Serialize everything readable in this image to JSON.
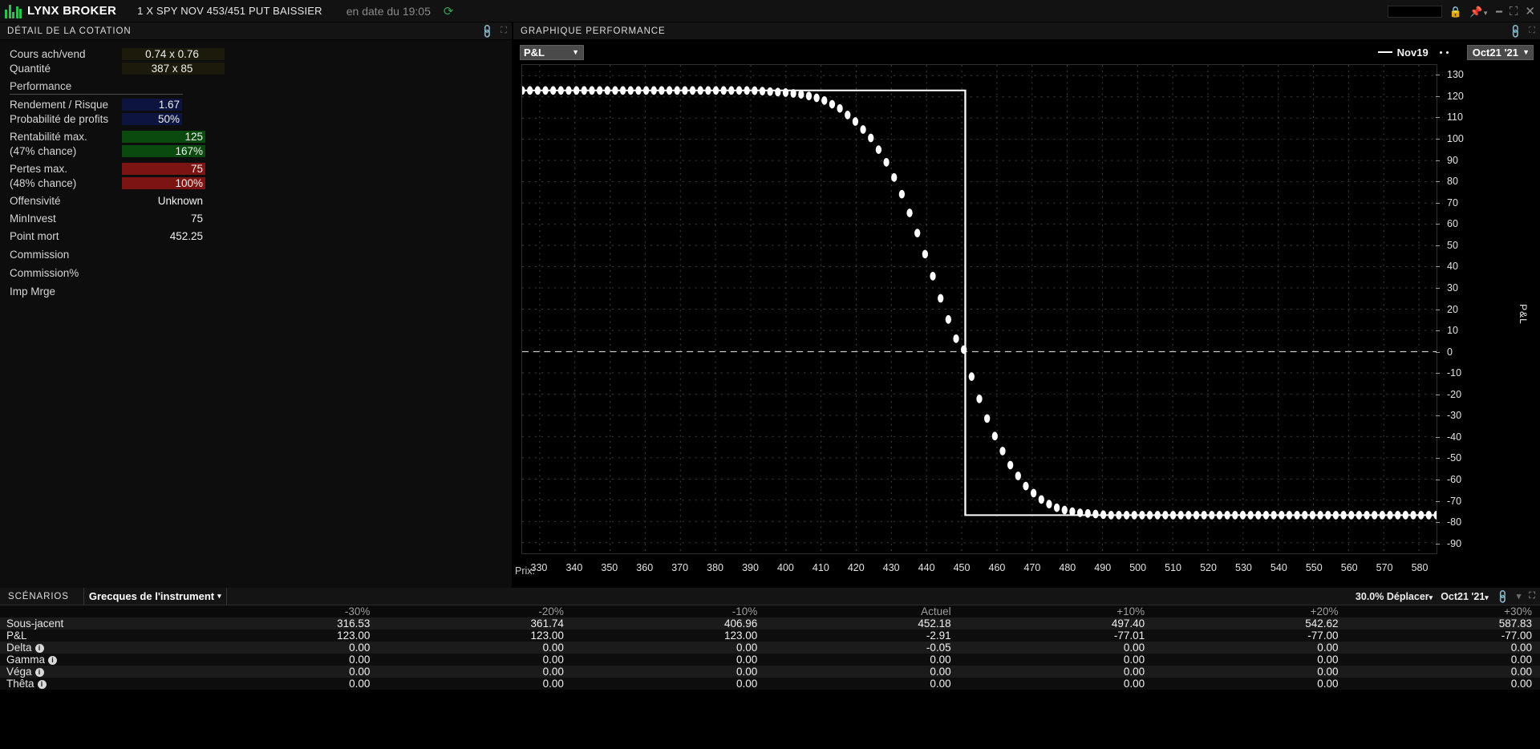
{
  "titlebar": {
    "brand": "LYNX BROKER",
    "instrument": "1 X SPY NOV 453/451 PUT BAISSIER",
    "asof": "en date du 19:05",
    "refresh_icon": "refresh-icon",
    "lock_icon": "lock-icon",
    "pin_icon": "pin-icon",
    "minimize_icon": "minimize-icon",
    "maximize_icon": "maximize-icon",
    "close_icon": "close-icon"
  },
  "quote_panel": {
    "title": "DÉTAIL DE LA COTATION",
    "link_icon": "link-icon",
    "expand_icon": "expand-icon",
    "rows": [
      {
        "label": "Cours ach/vend",
        "value": "0.74 x 0.76"
      },
      {
        "label": "Quantité",
        "value": "387 x 85"
      },
      {
        "label": "Performance",
        "value": ""
      },
      {
        "label": "Rendement / Risque",
        "value": "1.67"
      },
      {
        "label": "Probabilité de profits",
        "value": "50%"
      },
      {
        "label": "Rentabilité max.",
        "value": "125"
      },
      {
        "label": "(47% chance)",
        "value": "167%"
      },
      {
        "label": "Pertes max.",
        "value": "75"
      },
      {
        "label": "(48% chance)",
        "value": "100%"
      },
      {
        "label": "Offensivité",
        "value": "Unknown"
      },
      {
        "label": "MinInvest",
        "value": "75"
      },
      {
        "label": "Point mort",
        "value": "452.25"
      },
      {
        "label": "Commission",
        "value": ""
      },
      {
        "label": "Commission%",
        "value": ""
      },
      {
        "label": "Imp Mrge",
        "value": ""
      }
    ]
  },
  "chart_panel": {
    "title": "GRAPHIQUE PERFORMANCE",
    "link_icon": "link-icon",
    "expand_icon": "expand-icon",
    "metric_select": "P&L",
    "metric_caret": "▼",
    "legend_line": "Nov19",
    "date_select": "Oct21 '21",
    "date_caret": "▼",
    "x_prefix": "Prix:"
  },
  "chart_data": {
    "type": "line",
    "title": "GRAPHIQUE PERFORMANCE",
    "xlabel": "Prix:",
    "ylabel": "P&L",
    "xlim": [
      325,
      585
    ],
    "ylim": [
      -95,
      135
    ],
    "grid": true,
    "legend_position": "top-right",
    "x_ticks": [
      330,
      340,
      350,
      360,
      370,
      380,
      390,
      400,
      410,
      420,
      430,
      440,
      450,
      460,
      470,
      480,
      490,
      500,
      510,
      520,
      530,
      540,
      550,
      560,
      570,
      580
    ],
    "y_ticks": [
      130,
      120,
      110,
      100,
      90,
      80,
      70,
      60,
      50,
      40,
      30,
      20,
      10,
      0,
      -10,
      -20,
      -30,
      -40,
      -50,
      -60,
      -70,
      -80,
      -90
    ],
    "zero_line": 0,
    "series": [
      {
        "name": "Nov19",
        "style": "solid",
        "color": "#ffffff",
        "x": [
          325,
          451,
          451,
          585
        ],
        "values": [
          123,
          123,
          -77,
          -77
        ]
      },
      {
        "name": "Oct21 '21",
        "style": "dotted",
        "color": "#ffffff",
        "x": [
          325,
          330,
          340,
          350,
          360,
          370,
          380,
          390,
          400,
          405,
          410,
          415,
          420,
          424,
          428,
          432,
          436,
          440,
          444,
          448,
          451,
          452,
          456,
          460,
          464,
          468,
          472,
          476,
          480,
          484,
          488,
          492,
          496,
          500,
          510,
          520,
          530,
          540,
          550,
          560,
          570,
          580,
          585
        ],
        "values": [
          123,
          123,
          123,
          123,
          123,
          123,
          123,
          123,
          122,
          121,
          119,
          115,
          108,
          101,
          91,
          78,
          62,
          44,
          25,
          7,
          0,
          -8,
          -27,
          -42,
          -54,
          -63,
          -69,
          -73,
          -75,
          -76,
          -76.5,
          -77,
          -77,
          -77,
          -77,
          -77,
          -77,
          -77,
          -77,
          -77,
          -77,
          -77,
          -77
        ]
      }
    ]
  },
  "scenarios": {
    "title": "SCÉNARIOS",
    "tab": "Grecques de l'instrument",
    "tab_caret": "▾",
    "move_select": "30.0% Déplacer",
    "move_caret": "▾",
    "date_select": "Oct21 '21",
    "date_caret": "▾",
    "link_icon": "link-icon",
    "expand_icon": "expand-icon",
    "columns": [
      "",
      "-30%",
      "-20%",
      "-10%",
      "Actuel",
      "+10%",
      "+20%",
      "+30%"
    ],
    "rows": [
      {
        "label": "Sous-jacent",
        "info": false,
        "cells": [
          "316.53",
          "361.74",
          "406.96",
          "452.18",
          "497.40",
          "542.62",
          "587.83"
        ]
      },
      {
        "label": "P&L",
        "info": false,
        "cells": [
          "123.00",
          "123.00",
          "123.00",
          "-2.91",
          "-77.01",
          "-77.00",
          "-77.00"
        ]
      },
      {
        "label": "Delta",
        "info": true,
        "cells": [
          "0.00",
          "0.00",
          "0.00",
          "-0.05",
          "0.00",
          "0.00",
          "0.00"
        ]
      },
      {
        "label": "Gamma",
        "info": true,
        "cells": [
          "0.00",
          "0.00",
          "0.00",
          "0.00",
          "0.00",
          "0.00",
          "0.00"
        ]
      },
      {
        "label": "Véga",
        "info": true,
        "cells": [
          "0.00",
          "0.00",
          "0.00",
          "0.00",
          "0.00",
          "0.00",
          "0.00"
        ]
      },
      {
        "label": "Thêta",
        "info": true,
        "cells": [
          "0.00",
          "0.00",
          "0.00",
          "0.00",
          "0.00",
          "0.00",
          "0.00"
        ]
      }
    ]
  },
  "colors": {
    "brand_green": "#2fbf4f",
    "link_green": "#49c46a",
    "profit_green": "#0a4a0f",
    "loss_red": "#7d1414",
    "navy": "#0d1440",
    "highlight_olive": "#1c1a0b"
  }
}
